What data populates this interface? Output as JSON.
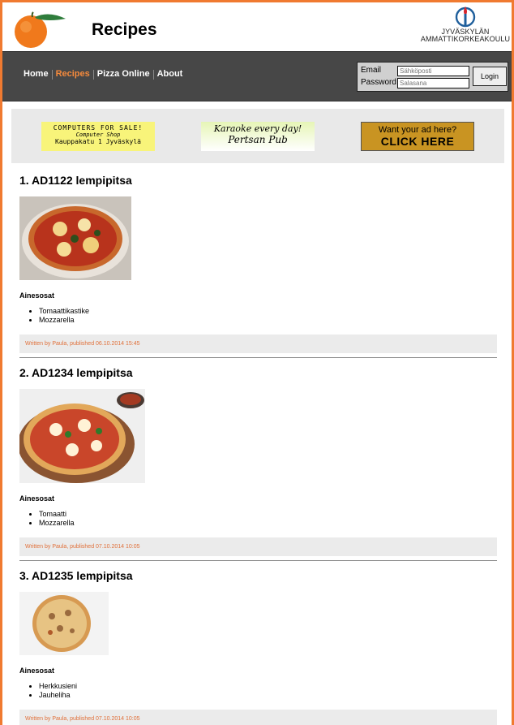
{
  "header": {
    "title": "Recipes",
    "school": [
      "JYVÄSKYLÄN",
      "AMMATTIKORKEAKOULU"
    ]
  },
  "nav": [
    {
      "label": "Home"
    },
    {
      "label": "Recipes"
    },
    {
      "label": "Pizza Online"
    },
    {
      "label": "About"
    }
  ],
  "login": {
    "email_label": "Email",
    "email_placeholder": "Sähköposti",
    "password_label": "Password",
    "password_placeholder": "Salasana",
    "button": "Login"
  },
  "ads": [
    {
      "line1": "COMPUTERS FOR SALE!",
      "line2": "Computer Shop",
      "line3": "Kauppakatu 1 Jyväskylä"
    },
    {
      "line1": "Karaoke every day!",
      "line2": "Pertsan Pub"
    },
    {
      "line1": "Want your ad here?",
      "line2": "CLICK HERE"
    }
  ],
  "posts": [
    {
      "title": "1. AD1122 lempipitsa",
      "ingredients_label": "Ainesosat",
      "ingredients": [
        "Tomaattikastike",
        "Mozzarella"
      ],
      "meta": "Written by Paula, published 06.10.2014 15:45"
    },
    {
      "title": "2. AD1234 lempipitsa",
      "ingredients_label": "Ainesosat",
      "ingredients": [
        "Tomaatti",
        "Mozzarella"
      ],
      "meta": "Written by Paula, published 07.10.2014 10:05"
    },
    {
      "title": "3. AD1235 lempipitsa",
      "ingredients_label": "Ainesosat",
      "ingredients": [
        "Herkkusieni",
        "Jauheliha"
      ],
      "meta": "Written by Paula, published 07.10.2014 10:05"
    }
  ],
  "colors": {
    "accent": "#f07a30",
    "nav_bg": "#474747",
    "nav_active": "#f58a3c",
    "meta_text": "#e0703a"
  }
}
